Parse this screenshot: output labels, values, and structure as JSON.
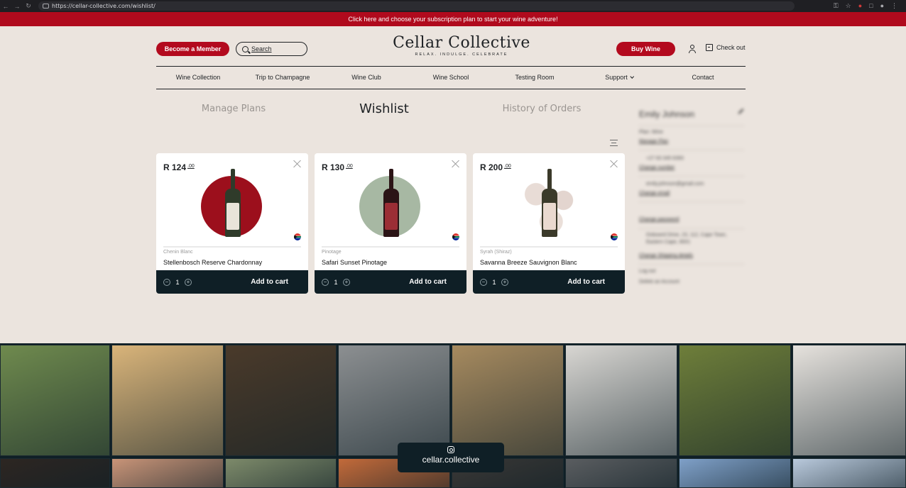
{
  "browser": {
    "url": "https://cellar-collective.com/wishlist/"
  },
  "promo": {
    "text": "Click here and choose your subscription plan to start your wine adventure!"
  },
  "header": {
    "become_member": "Become a Member",
    "search_label": "Search",
    "logo_name": "Cellar Collective",
    "logo_tagline": "RELAX. INDULGE. CELEBRATE",
    "buy_wine": "Buy Wine",
    "checkout": "Check out"
  },
  "nav": {
    "items": [
      "Wine Collection",
      "Trip to Champagne",
      "Wine Club",
      "Wine School",
      "Testing Room",
      "Support",
      "Contact"
    ]
  },
  "tabs": {
    "manage_plans": "Manage Plans",
    "wishlist": "Wishlist",
    "history": "History of Orders"
  },
  "products": [
    {
      "price": "R 124",
      "cents": ".00",
      "variety": "Chenin Blanc",
      "name": "Stellenbosch Reserve Chardonnay",
      "qty": "1",
      "add_to_cart": "Add to cart",
      "circle_color": "#9c0f1c",
      "bottle_color": "#2f3b2a",
      "label_color": "#e9e4d9"
    },
    {
      "price": "R 130",
      "cents": ".00",
      "variety": "Pinotage",
      "name": "Safari Sunset Pinotage",
      "qty": "1",
      "add_to_cart": "Add to cart",
      "circle_color": "#a7b8a3",
      "bottle_color": "#2b1416",
      "label_color": "#9b2e35"
    },
    {
      "price": "R 200",
      "cents": ".00",
      "variety": "Syrah (Shiraz)",
      "name": "Savanna Breeze Sauvignon Blanc",
      "qty": "1",
      "add_to_cart": "Add to cart",
      "circle_color": "#f1ebe7",
      "bottle_color": "#3b3a2a",
      "label_color": "#ead9cf"
    }
  ],
  "account": {
    "name": "Emily Johnson",
    "plan": "Plan: Wine",
    "manage_plan": "Manage Plan",
    "phone": "+27 63 345 6393",
    "change_number": "Change number",
    "email": "emily.johnson@gmail.com",
    "change_email": "Change email",
    "change_password": "Change password",
    "address": "Oxbowrd Drive, 23, 112, Cape Town, Eastern Cape, 8001",
    "change_shipping": "Change Shipping details",
    "log_out": "Log out",
    "delete_account": "Delete an Account"
  },
  "instagram": {
    "handle": "cellar.collective",
    "tile_colors": [
      "#6f8a4e",
      "#d9b47a",
      "#4a3a2a",
      "#8c8f91",
      "#a68a5f",
      "#d8d6d2",
      "#6e7e3a",
      "#e6e2dd",
      "#2d2622",
      "#c89478",
      "#7d8a6a",
      "#c26a3a",
      "#3a3836",
      "#5a5d60",
      "#7fa0c8",
      "#b9c9dc"
    ]
  }
}
